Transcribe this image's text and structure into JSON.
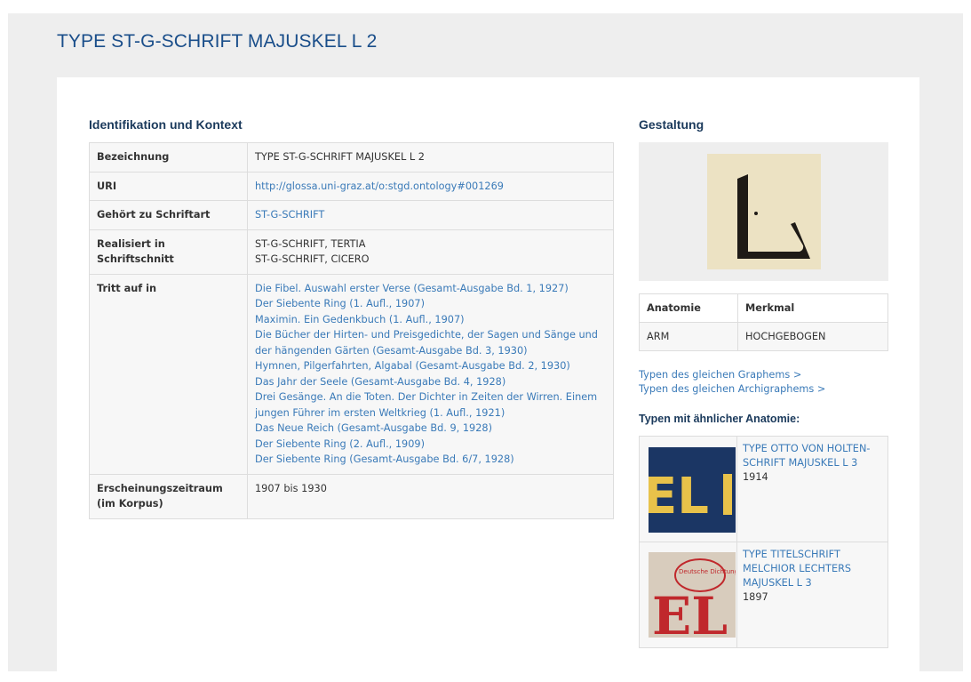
{
  "page_title": "TYPE ST-G-SCHRIFT MAJUSKEL L 2",
  "identification": {
    "heading": "Identifikation und Kontext",
    "rows": {
      "bezeichnung": {
        "label": "Bezeichnung",
        "value": "TYPE ST-G-SCHRIFT MAJUSKEL L 2"
      },
      "uri": {
        "label": "URI",
        "value": "http://glossa.uni-graz.at/o:stgd.ontology#001269"
      },
      "schriftart": {
        "label": "Gehört zu Schriftart",
        "value": "ST-G-SCHRIFT"
      },
      "schriftschnitt": {
        "label": "Realisiert in Schriftschnitt",
        "values": [
          "ST-G-SCHRIFT, TERTIA",
          "ST-G-SCHRIFT, CICERO"
        ]
      },
      "tritt_auf": {
        "label": "Tritt auf in",
        "items": [
          "Die Fibel. Auswahl erster Verse (Gesamt-Ausgabe Bd. 1, 1927)",
          "Der Siebente Ring (1. Aufl., 1907)",
          "Maximin. Ein Gedenkbuch (1. Aufl., 1907)",
          "Die Bücher der Hirten- und Preisgedichte, der Sagen und Sänge und der hängenden Gärten (Gesamt-Ausgabe Bd. 3, 1930)",
          "Hymnen, Pilgerfahrten, Algabal (Gesamt-Ausgabe Bd. 2, 1930)",
          "Das Jahr der Seele (Gesamt-Ausgabe Bd. 4, 1928)",
          "Drei Gesänge. An die Toten. Der Dichter in Zeiten der Wirren. Einem jungen Führer im ersten Weltkrieg (1. Aufl., 1921)",
          "Das Neue Reich (Gesamt-Ausgabe Bd. 9, 1928)",
          "Der Siebente Ring (2. Aufl., 1909)",
          "Der Siebente Ring (Gesamt-Ausgabe Bd. 6/7, 1928)"
        ]
      },
      "zeitraum": {
        "label": "Erscheinungszeitraum (im Korpus)",
        "value": "1907 bis 1930"
      }
    }
  },
  "gestaltung": {
    "heading": "Gestaltung",
    "anatomy_table": {
      "col1": "Anatomie",
      "col2": "Merkmal",
      "row": {
        "anatomie": "ARM",
        "merkmal": "HOCHGEBOGEN"
      }
    },
    "links": {
      "same_grapheme": "Typen des gleichen Graphems >",
      "same_archigrapheme": "Typen des gleichen Archigraphems >"
    },
    "similar_heading": "Typen mit ähnlicher Anatomie:",
    "similar": [
      {
        "name": "TYPE OTTO VON HOLTEN-SCHRIFT MAJUSKEL L 3",
        "year": "1914"
      },
      {
        "name": "TYPE TITELSCHRIFT MELCHIOR LECHTERS MAJUSKEL L 3",
        "year": "1897"
      }
    ]
  },
  "thumb_texts": {
    "holten": "EL",
    "lechter_top": "Deutsche Dichtung",
    "lechter_big": "EL"
  },
  "colors": {
    "title": "#1a4e8a",
    "link": "#3a7ab8",
    "heading": "#1b3a5c",
    "glyph_paper": "#ece2c3",
    "holten_blue": "#1e3a6a",
    "holten_yellow": "#e8c24a",
    "lechter_red": "#c0282c"
  }
}
